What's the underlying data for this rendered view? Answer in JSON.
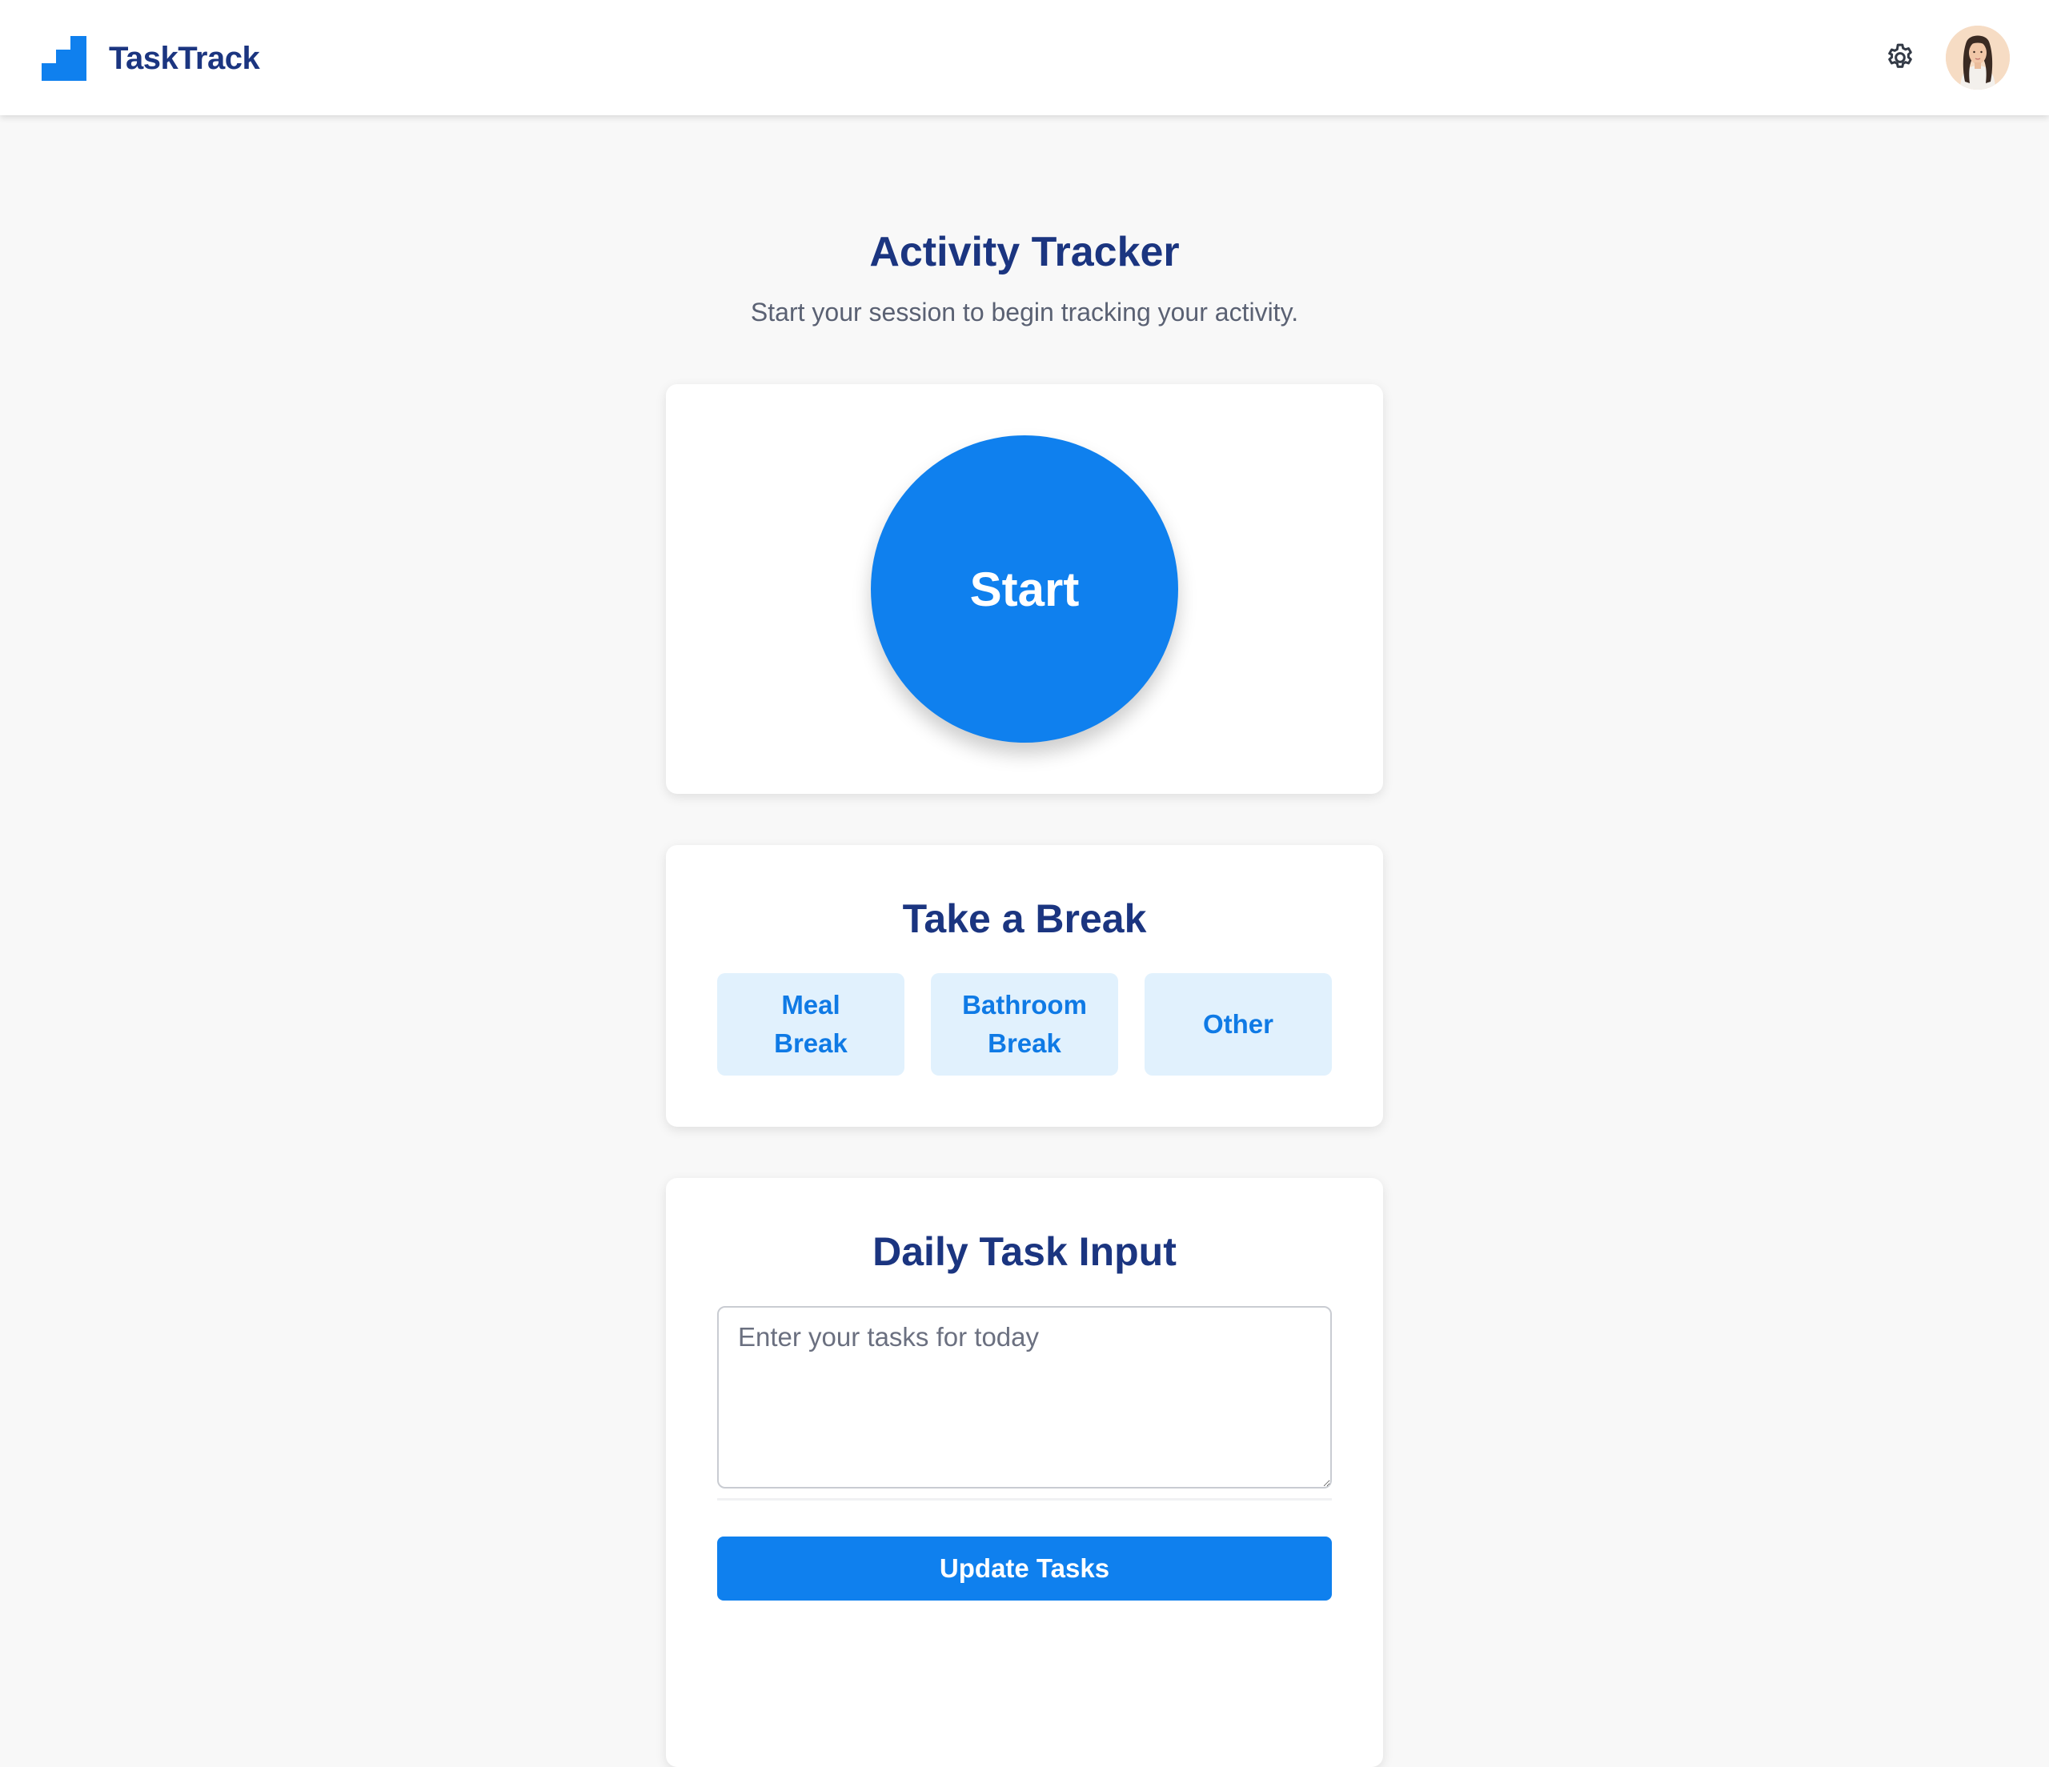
{
  "app": {
    "name": "TaskTrack",
    "logo_icon": "stairs-logo-icon",
    "brand_color": "#0f80ee",
    "title_color": "#1b3580"
  },
  "header": {
    "settings_icon": "gear-icon",
    "avatar": "user-avatar"
  },
  "main": {
    "title": "Activity Tracker",
    "subtitle": "Start your session to begin tracking your activity."
  },
  "session": {
    "start_label": "Start"
  },
  "breaks": {
    "heading": "Take a Break",
    "options": [
      "Meal Break",
      "Bathroom Break",
      "Other"
    ]
  },
  "tasks": {
    "heading": "Daily Task Input",
    "placeholder": "Enter your tasks for today",
    "value": "",
    "update_label": "Update Tasks"
  }
}
